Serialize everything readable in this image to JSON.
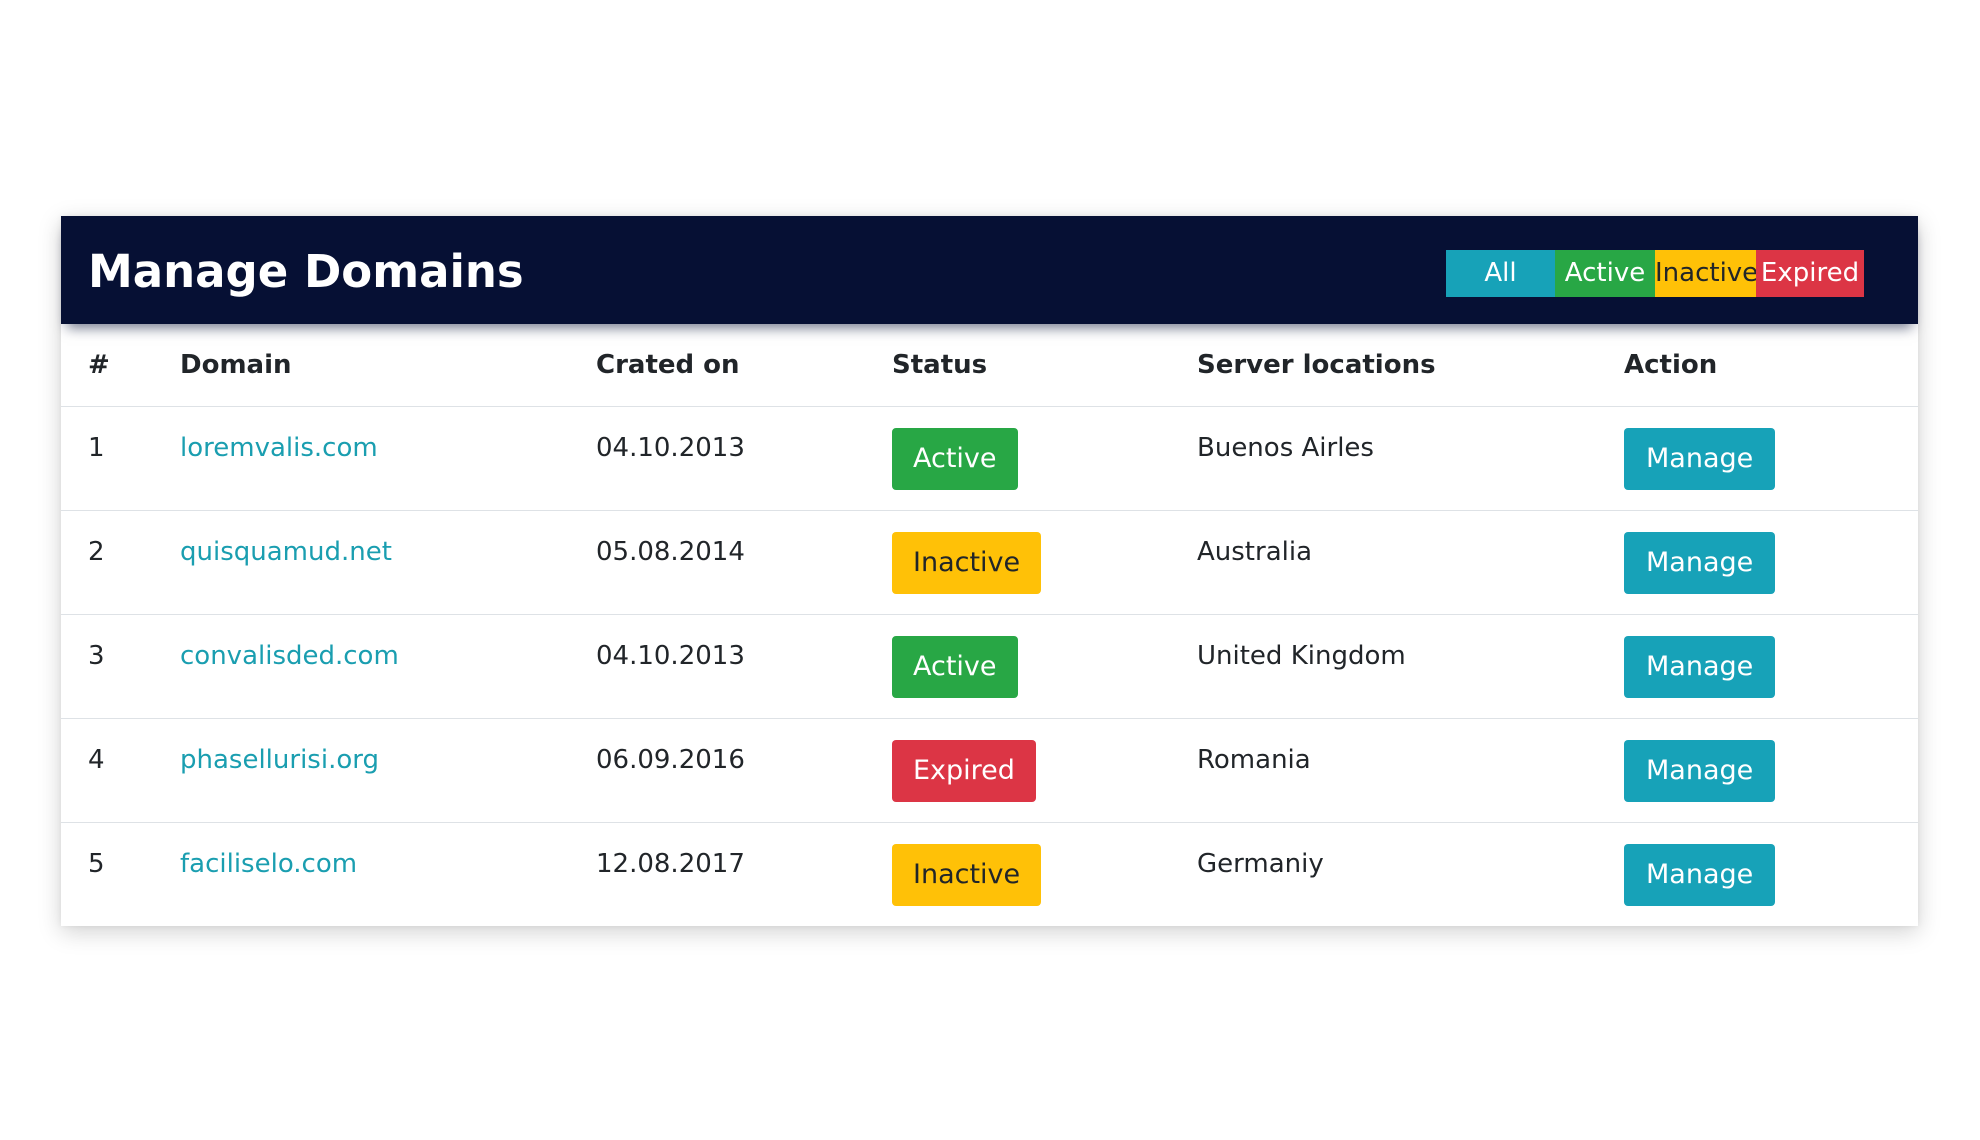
{
  "header": {
    "title": "Manage Domains",
    "filters": [
      {
        "label": "All",
        "bg": "#17a2b8",
        "fg": "#ffffff"
      },
      {
        "label": "Active",
        "bg": "#28a745",
        "fg": "#ffffff"
      },
      {
        "label": "Inactive",
        "bg": "#ffc107",
        "fg": "#212529"
      },
      {
        "label": "Expired",
        "bg": "#dc3545",
        "fg": "#ffffff"
      }
    ]
  },
  "table": {
    "columns": [
      "#",
      "Domain",
      "Crated on",
      "Status",
      "Server locations",
      "Action"
    ],
    "rows": [
      {
        "num": "1",
        "domain": "loremvalis.com",
        "created": "04.10.2013",
        "status": "Active",
        "status_color": "#28a745",
        "status_fg": "#ffffff",
        "location": "Buenos Airles",
        "action": "Manage"
      },
      {
        "num": "2",
        "domain": "quisquamud.net",
        "created": "05.08.2014",
        "status": "Inactive",
        "status_color": "#ffc107",
        "status_fg": "#212529",
        "location": "Australia",
        "action": "Manage"
      },
      {
        "num": "3",
        "domain": "convalisded.com",
        "created": "04.10.2013",
        "status": "Active",
        "status_color": "#28a745",
        "status_fg": "#ffffff",
        "location": "United Kingdom",
        "action": "Manage"
      },
      {
        "num": "4",
        "domain": "phasellurisi.org",
        "created": "06.09.2016",
        "status": "Expired",
        "status_color": "#dc3545",
        "status_fg": "#ffffff",
        "location": "Romania",
        "action": "Manage"
      },
      {
        "num": "5",
        "domain": "faciliselo.com",
        "created": "12.08.2017",
        "status": "Inactive",
        "status_color": "#ffc107",
        "status_fg": "#212529",
        "location": "Germaniy",
        "action": "Manage"
      }
    ]
  }
}
